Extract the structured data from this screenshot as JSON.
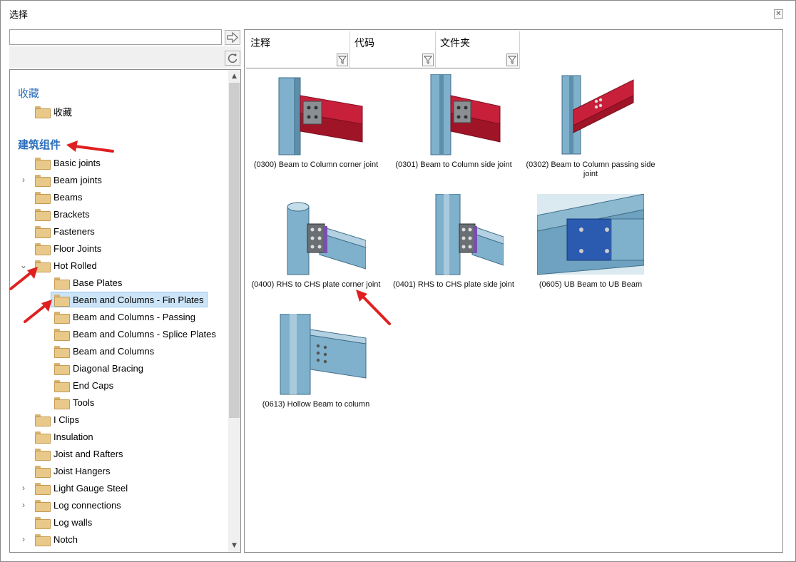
{
  "window": {
    "title": "选择"
  },
  "search": {
    "value": "",
    "placeholder": ""
  },
  "tree": {
    "favorites_header": "收藏",
    "favorites_item": "收藏",
    "components_header": "建筑组件",
    "items": [
      {
        "label": "Basic joints",
        "expander": ""
      },
      {
        "label": "Beam joints",
        "expander": ">"
      },
      {
        "label": "Beams",
        "expander": ""
      },
      {
        "label": "Brackets",
        "expander": ""
      },
      {
        "label": "Fasteners",
        "expander": ""
      },
      {
        "label": "Floor Joints",
        "expander": ""
      },
      {
        "label": "Hot Rolled",
        "expander": "v"
      },
      {
        "label": "Base Plates",
        "expander": ""
      },
      {
        "label": "Beam and Columns - Fin Plates",
        "expander": "",
        "selected": true
      },
      {
        "label": "Beam and Columns - Passing",
        "expander": ""
      },
      {
        "label": "Beam and Columns - Splice Plates",
        "expander": ""
      },
      {
        "label": "Beam and Columns",
        "expander": ""
      },
      {
        "label": "Diagonal Bracing",
        "expander": ""
      },
      {
        "label": "End Caps",
        "expander": ""
      },
      {
        "label": "Tools",
        "expander": ""
      },
      {
        "label": "I Clips",
        "expander": ""
      },
      {
        "label": "Insulation",
        "expander": ""
      },
      {
        "label": "Joist and Rafters",
        "expander": ""
      },
      {
        "label": "Joist Hangers",
        "expander": ""
      },
      {
        "label": "Light Gauge Steel",
        "expander": ">"
      },
      {
        "label": "Log connections",
        "expander": ">"
      },
      {
        "label": "Log walls",
        "expander": ""
      },
      {
        "label": "Notch",
        "expander": ">"
      }
    ]
  },
  "columns": [
    {
      "label": "注释"
    },
    {
      "label": "代码"
    },
    {
      "label": "文件夹"
    }
  ],
  "gallery": [
    {
      "caption": "(0300) Beam to Column corner joint",
      "icon": "beam-column-corner-red"
    },
    {
      "caption": "(0301) Beam to Column side joint",
      "icon": "beam-column-side-red"
    },
    {
      "caption": "(0302) Beam to Column passing side joint",
      "icon": "beam-column-passing-red"
    },
    {
      "caption": "(0400) RHS to CHS plate corner joint",
      "icon": "rhs-chs-corner"
    },
    {
      "caption": "(0401) RHS to CHS plate side joint",
      "icon": "rhs-chs-side"
    },
    {
      "caption": "(0605) UB Beam to UB Beam",
      "icon": "ub-beam-ub-beam"
    },
    {
      "caption": "(0613) Hollow Beam to column",
      "icon": "hollow-beam-column"
    }
  ],
  "colors": {
    "accent_blue": "#2a6ebb",
    "selection": "#cce4f7",
    "annotation_red": "#e02020",
    "beam_red": "#c8203a",
    "steel_blue": "#6fa1c0"
  }
}
